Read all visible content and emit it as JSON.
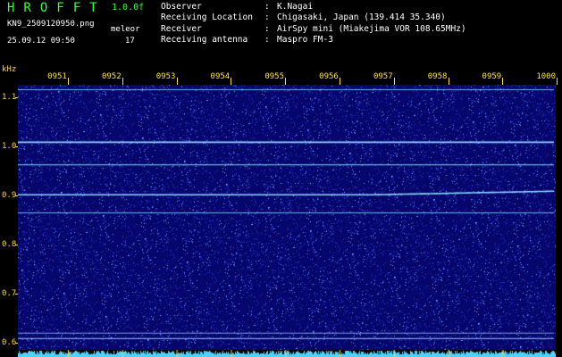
{
  "header": {
    "brand": "HROFFT",
    "version": "1.0.0f",
    "filename": "KN9_2509120950.png",
    "mode": "meleor",
    "date": "25.09.12 09:50",
    "count": "17"
  },
  "meta": [
    {
      "key": "Observer",
      "value": "K.Nagai"
    },
    {
      "key": "Receiving Location",
      "value": "Chigasaki, Japan (139.414 35.340)"
    },
    {
      "key": "Receiver",
      "value": "AirSpy mini (Miakejima VOR 108.65MHz)"
    },
    {
      "key": "Receiving antenna",
      "value": "Maspro FM-3"
    }
  ],
  "axis": {
    "y_unit": "kHz",
    "y_ticks": [
      "1.1",
      "1.0",
      "0.9",
      "0.8",
      "0.7",
      "0.6"
    ],
    "x_ticks": [
      "0951",
      "0952",
      "0953",
      "0954",
      "0955",
      "0956",
      "0957",
      "0958",
      "0959",
      "1000"
    ]
  },
  "colors": {
    "background": "#0a0a6e",
    "trace": "#8fd8ff",
    "accent": "#ffd23a",
    "brand": "#33ff33"
  },
  "traces_khz": [
    1.115,
    1.008,
    0.962,
    0.901,
    0.864,
    0.619,
    0.608
  ]
}
